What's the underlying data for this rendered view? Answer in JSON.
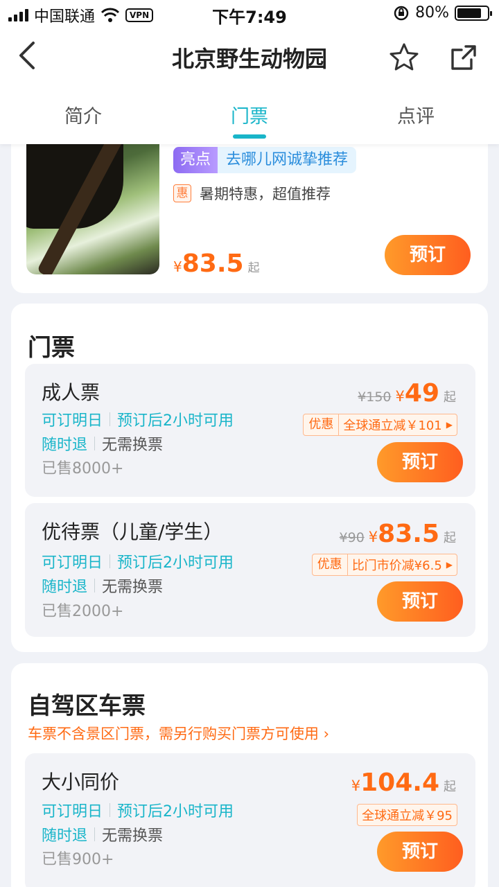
{
  "status_bar": {
    "carrier": "中国联通",
    "vpn": "VPN",
    "time": "下午7:49",
    "battery": "80%"
  },
  "nav": {
    "title": "北京野生动物园"
  },
  "tabs": [
    {
      "label": "简介"
    },
    {
      "label": "门票"
    },
    {
      "label": "点评"
    }
  ],
  "active_tab": "门票",
  "top_card": {
    "highlight_tag": "亮点",
    "highlight_text": "去哪儿网诚挚推荐",
    "promo_icon": "惠",
    "promo_text": "暑期特惠，超值推荐",
    "currency": "¥",
    "price": "83.5",
    "price_suffix": "起",
    "book_label": "预订"
  },
  "tickets_section": {
    "title": "门票",
    "items": [
      {
        "name": "成人票",
        "tag1": "可订明日",
        "tag2": "预订后2小时可用",
        "tag3": "随时退",
        "tag4": "无需换票",
        "sold": "已售8000+",
        "orig_price": "¥150",
        "currency": "¥",
        "price": "49",
        "price_suffix": "起",
        "discount_label": "优惠",
        "discount_text": "全球通立减￥101",
        "book_label": "预订"
      },
      {
        "name": "优待票（儿童/学生）",
        "tag1": "可订明日",
        "tag2": "预订后2小时可用",
        "tag3": "随时退",
        "tag4": "无需换票",
        "sold": "已售2000+",
        "orig_price": "¥90",
        "currency": "¥",
        "price": "83.5",
        "price_suffix": "起",
        "discount_label": "优惠",
        "discount_text": "比门市价减¥6.5",
        "book_label": "预订"
      }
    ]
  },
  "car_section": {
    "title": "自驾区车票",
    "notice": "车票不含景区门票，需另行购买门票方可使用 ›",
    "items": [
      {
        "name": "大小同价",
        "tag1": "可订明日",
        "tag2": "预订后2小时可用",
        "tag3": "随时退",
        "tag4": "无需换票",
        "sold": "已售900+",
        "currency": "¥",
        "price": "104.4",
        "price_suffix": "起",
        "discount_text": "全球通立减￥95",
        "book_label": "预订"
      }
    ]
  },
  "colors": {
    "accent": "#19b5c9",
    "price": "#ff6a13",
    "button_start": "#ff9a2a",
    "button_end": "#ff5e1f"
  },
  "icons": [
    "signal-icon",
    "wifi-icon",
    "orientation-lock-icon",
    "battery-icon",
    "back-arrow-icon",
    "star-icon",
    "share-icon"
  ]
}
